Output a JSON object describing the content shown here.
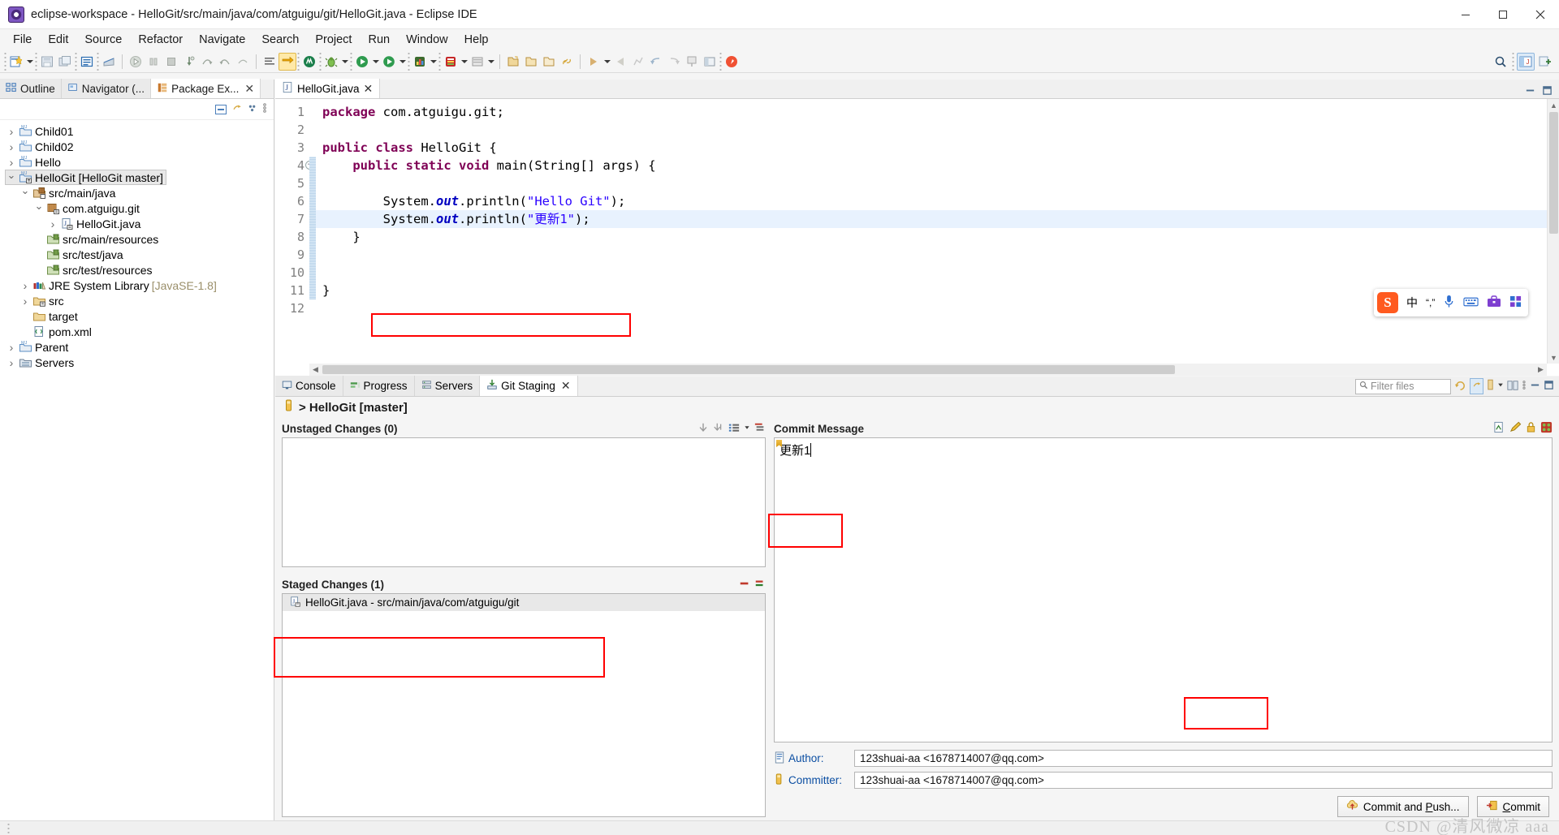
{
  "window": {
    "title": "eclipse-workspace - HelloGit/src/main/java/com/atguigu/git/HelloGit.java - Eclipse IDE",
    "app_icon": "eclipse-icon",
    "minimize": "minimize-icon",
    "maximize": "maximize-icon",
    "close": "close-icon"
  },
  "menubar": {
    "items": [
      "File",
      "Edit",
      "Source",
      "Refactor",
      "Navigate",
      "Search",
      "Project",
      "Run",
      "Window",
      "Help"
    ]
  },
  "toolbar": {
    "right_items": [
      "search-icon",
      "perspective-java-icon",
      "perspective-add-icon"
    ]
  },
  "left_panel": {
    "tabs": [
      {
        "label": "Outline",
        "icon": "outline-icon",
        "active": false,
        "closable": false
      },
      {
        "label": "Navigator (...",
        "icon": "navigator-icon",
        "active": false,
        "closable": false
      },
      {
        "label": "Package Ex...",
        "icon": "package-explorer-icon",
        "active": true,
        "closable": true
      }
    ],
    "tree": [
      {
        "indent": 0,
        "arrow": "closed",
        "icon": "java-project-icon",
        "label": "Child01",
        "dim": "",
        "selected": false
      },
      {
        "indent": 0,
        "arrow": "closed",
        "icon": "java-project-icon",
        "label": "Child02",
        "dim": "",
        "selected": false
      },
      {
        "indent": 0,
        "arrow": "closed",
        "icon": "java-project-icon",
        "label": "Hello",
        "dim": "",
        "selected": false
      },
      {
        "indent": 0,
        "arrow": "open",
        "icon": "java-project-git-icon",
        "label": "HelloGit [HelloGit master]",
        "dim": "",
        "selected": true
      },
      {
        "indent": 1,
        "arrow": "open",
        "icon": "source-folder-git-icon",
        "label": "src/main/java",
        "dim": "",
        "selected": false
      },
      {
        "indent": 2,
        "arrow": "open",
        "icon": "package-git-icon",
        "label": "com.atguigu.git",
        "dim": "",
        "selected": false
      },
      {
        "indent": 3,
        "arrow": "closed",
        "icon": "java-file-git-icon",
        "label": "HelloGit.java",
        "dim": "",
        "selected": false
      },
      {
        "indent": 2,
        "arrow": "none",
        "icon": "source-folder-icon",
        "label": "src/main/resources",
        "dim": "",
        "selected": false
      },
      {
        "indent": 2,
        "arrow": "none",
        "icon": "source-folder-icon",
        "label": "src/test/java",
        "dim": "",
        "selected": false
      },
      {
        "indent": 2,
        "arrow": "none",
        "icon": "source-folder-icon",
        "label": "src/test/resources",
        "dim": "",
        "selected": false
      },
      {
        "indent": 1,
        "arrow": "closed",
        "icon": "library-icon",
        "label": "JRE System Library",
        "dim": "[JavaSE-1.8]",
        "selected": false
      },
      {
        "indent": 1,
        "arrow": "closed",
        "icon": "folder-git-icon",
        "label": "src",
        "dim": "",
        "selected": false
      },
      {
        "indent": 1,
        "arrow": "none",
        "icon": "folder-icon",
        "label": "target",
        "dim": "",
        "selected": false
      },
      {
        "indent": 1,
        "arrow": "none",
        "icon": "xml-file-icon",
        "label": "pom.xml",
        "dim": "",
        "selected": false
      },
      {
        "indent": 0,
        "arrow": "closed",
        "icon": "java-project-icon",
        "label": "Parent",
        "dim": "",
        "selected": false
      },
      {
        "indent": 0,
        "arrow": "closed",
        "icon": "servers-folder-icon",
        "label": "Servers",
        "dim": "",
        "selected": false
      }
    ]
  },
  "editor": {
    "tab": {
      "label": "HelloGit.java",
      "icon": "java-file-icon",
      "close": "close-icon"
    },
    "lines": [
      {
        "no": 1,
        "fold": false,
        "highlight": false,
        "tokens": [
          {
            "t": "package",
            "c": "kw"
          },
          {
            "t": " com.atguigu.git;",
            "c": ""
          }
        ]
      },
      {
        "no": 2,
        "fold": false,
        "highlight": false,
        "tokens": []
      },
      {
        "no": 3,
        "fold": false,
        "highlight": false,
        "tokens": [
          {
            "t": "public",
            "c": "kw"
          },
          {
            "t": " ",
            "c": ""
          },
          {
            "t": "class",
            "c": "kw"
          },
          {
            "t": " HelloGit {",
            "c": ""
          }
        ]
      },
      {
        "no": 4,
        "fold": true,
        "highlight": false,
        "tokens": [
          {
            "t": "    ",
            "c": ""
          },
          {
            "t": "public",
            "c": "kw"
          },
          {
            "t": " ",
            "c": ""
          },
          {
            "t": "static",
            "c": "kw"
          },
          {
            "t": " ",
            "c": ""
          },
          {
            "t": "void",
            "c": "kw"
          },
          {
            "t": " main(String[] args) {",
            "c": ""
          }
        ]
      },
      {
        "no": 5,
        "fold": false,
        "highlight": false,
        "tokens": []
      },
      {
        "no": 6,
        "fold": false,
        "highlight": false,
        "tokens": [
          {
            "t": "        System.",
            "c": ""
          },
          {
            "t": "out",
            "c": "fld"
          },
          {
            "t": ".println(",
            "c": ""
          },
          {
            "t": "\"Hello Git\"",
            "c": "str"
          },
          {
            "t": ");",
            "c": ""
          }
        ]
      },
      {
        "no": 7,
        "fold": false,
        "highlight": true,
        "tokens": [
          {
            "t": "        System.",
            "c": ""
          },
          {
            "t": "out",
            "c": "fld"
          },
          {
            "t": ".println(",
            "c": ""
          },
          {
            "t": "\"更新1\"",
            "c": "str"
          },
          {
            "t": ");",
            "c": ""
          }
        ]
      },
      {
        "no": 8,
        "fold": false,
        "highlight": false,
        "tokens": [
          {
            "t": "    }",
            "c": ""
          }
        ]
      },
      {
        "no": 9,
        "fold": false,
        "highlight": false,
        "tokens": []
      },
      {
        "no": 10,
        "fold": false,
        "highlight": false,
        "tokens": []
      },
      {
        "no": 11,
        "fold": false,
        "highlight": false,
        "tokens": [
          {
            "t": "}",
            "c": ""
          }
        ]
      },
      {
        "no": 12,
        "fold": false,
        "highlight": false,
        "tokens": []
      }
    ]
  },
  "bottom": {
    "tabs": [
      {
        "label": "Console",
        "icon": "console-icon",
        "active": false,
        "closable": false
      },
      {
        "label": "Progress",
        "icon": "progress-icon",
        "active": false,
        "closable": false
      },
      {
        "label": "Servers",
        "icon": "servers-icon",
        "active": false,
        "closable": false
      },
      {
        "label": "Git Staging",
        "icon": "git-staging-icon",
        "active": true,
        "closable": true
      }
    ],
    "filter_placeholder": "Filter files",
    "repository": "> HelloGit [master]",
    "unstaged": {
      "title": "Unstaged Changes (0)",
      "rows": []
    },
    "staged": {
      "title": "Staged Changes (1)",
      "rows": [
        {
          "icon": "java-file-staged-icon",
          "label": "HelloGit.java - src/main/java/com/atguigu/git"
        }
      ]
    },
    "commit_message": {
      "title": "Commit Message",
      "value": "更新1",
      "placeholder": ""
    },
    "author": {
      "label": "Author:",
      "value": "123shuai-aa <1678714007@qq.com>"
    },
    "committer": {
      "label": "Committer:",
      "value": "123shuai-aa <1678714007@qq.com>"
    },
    "buttons": {
      "commit_and_push": "Commit and Push...",
      "commit_and_push_mnemonic": "P",
      "commit": "Commit",
      "commit_mnemonic": "C"
    }
  },
  "ime": {
    "logo": "S",
    "items": [
      "中",
      "“,”",
      "mic-icon",
      "keyboard-icon",
      "toolbox-icon",
      "apps-icon"
    ]
  },
  "statusbar": {
    "watermark": "CSDN @清风微凉 aaa"
  },
  "annotations": {
    "color": "#ff0000",
    "boxes": [
      "code-line-7-box",
      "staged-changes-box",
      "commit-message-box",
      "commit-button-box"
    ]
  }
}
